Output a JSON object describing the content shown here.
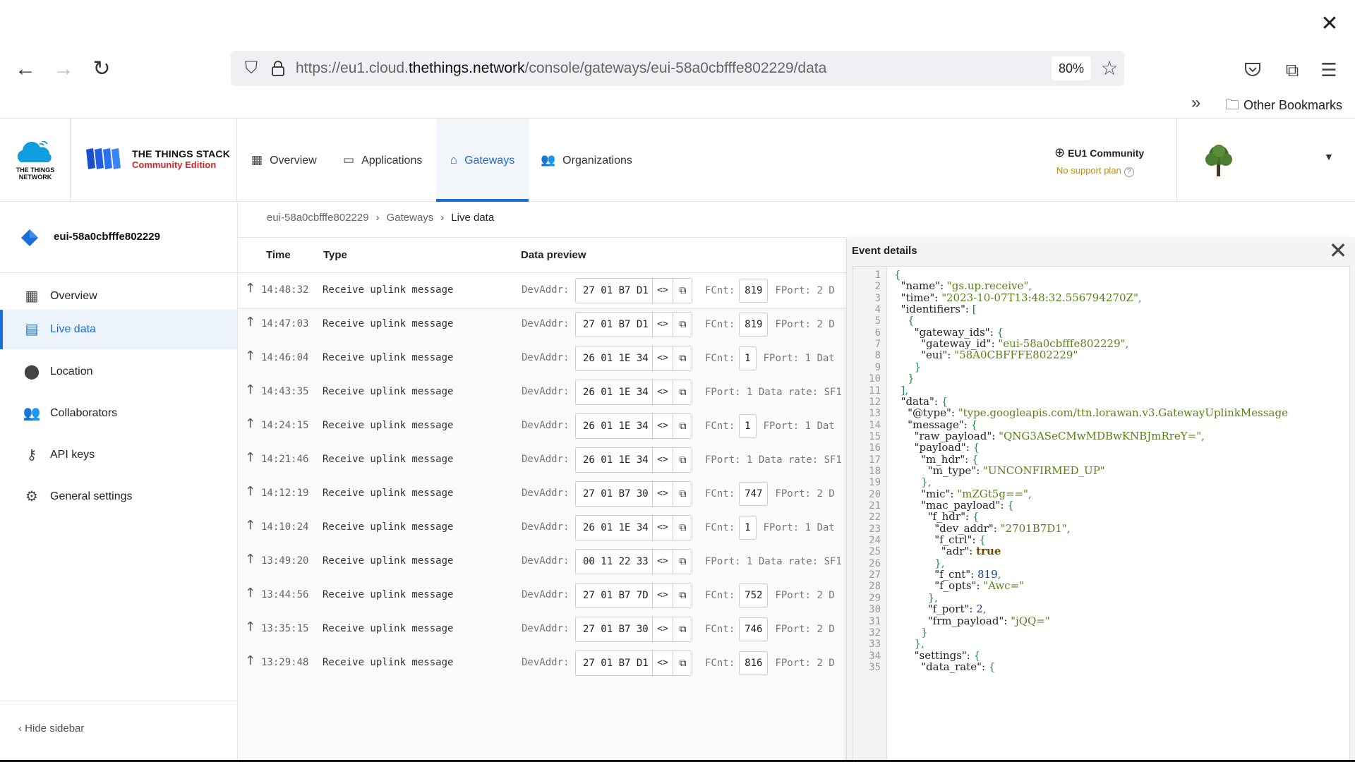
{
  "browser": {
    "url_prefix": "https://eu1.cloud.",
    "url_domain": "thethings.network",
    "url_path": "/console/gateways/eui-58a0cbfffe802229/data",
    "zoom": "80%",
    "other_bookmarks": "Other Bookmarks"
  },
  "header": {
    "ttn_logo_text": "THE THINGS NETWORK",
    "tts_title": "THE THINGS STACK",
    "tts_subtitle": "Community Edition",
    "nav": {
      "overview": "Overview",
      "applications": "Applications",
      "gateways": "Gateways",
      "organizations": "Organizations"
    },
    "cluster": "EU1 Community",
    "support": "No support plan"
  },
  "sidebar": {
    "gateway_name": "eui-58a0cbfffe802229",
    "items": [
      {
        "label": "Overview",
        "icon": "dashboard-icon"
      },
      {
        "label": "Live data",
        "icon": "live-data-icon"
      },
      {
        "label": "Location",
        "icon": "location-pin-icon"
      },
      {
        "label": "Collaborators",
        "icon": "people-icon"
      },
      {
        "label": "API keys",
        "icon": "key-icon"
      },
      {
        "label": "General settings",
        "icon": "gear-icon"
      }
    ],
    "hide_label": "Hide sidebar"
  },
  "breadcrumb": {
    "item1": "eui-58a0cbfffe802229",
    "item2": "Gateways",
    "item3": "Live data"
  },
  "table": {
    "columns": {
      "time": "Time",
      "type": "Type",
      "preview": "Data preview"
    },
    "devaddr_label": "DevAddr:",
    "rows": [
      {
        "time": "14:48:32",
        "type": "Receive uplink message",
        "devaddr": "27 01 B7 D1",
        "fcnt": "819",
        "tail": "FPort: 2  D"
      },
      {
        "time": "14:47:03",
        "type": "Receive uplink message",
        "devaddr": "27 01 B7 D1",
        "fcnt": "819",
        "tail": "FPort: 2  D"
      },
      {
        "time": "14:46:04",
        "type": "Receive uplink message",
        "devaddr": "26 01 1E 34",
        "fcnt": "1",
        "tail": "FPort: 1  Dat"
      },
      {
        "time": "14:43:35",
        "type": "Receive uplink message",
        "devaddr": "26 01 1E 34",
        "fcnt": "",
        "tail": "FPort: 1  Data rate: SF1"
      },
      {
        "time": "14:24:15",
        "type": "Receive uplink message",
        "devaddr": "26 01 1E 34",
        "fcnt": "1",
        "tail": "FPort: 1  Dat"
      },
      {
        "time": "14:21:46",
        "type": "Receive uplink message",
        "devaddr": "26 01 1E 34",
        "fcnt": "",
        "tail": "FPort: 1  Data rate: SF1"
      },
      {
        "time": "14:12:19",
        "type": "Receive uplink message",
        "devaddr": "27 01 B7 30",
        "fcnt": "747",
        "tail": "FPort: 2  D"
      },
      {
        "time": "14:10:24",
        "type": "Receive uplink message",
        "devaddr": "26 01 1E 34",
        "fcnt": "1",
        "tail": "FPort: 1  Dat"
      },
      {
        "time": "13:49:20",
        "type": "Receive uplink message",
        "devaddr": "00 11 22 33",
        "fcnt": "",
        "tail": "FPort: 1  Data rate: SF1"
      },
      {
        "time": "13:44:56",
        "type": "Receive uplink message",
        "devaddr": "27 01 B7 7D",
        "fcnt": "752",
        "tail": "FPort: 2  D"
      },
      {
        "time": "13:35:15",
        "type": "Receive uplink message",
        "devaddr": "27 01 B7 30",
        "fcnt": "746",
        "tail": "FPort: 2  D"
      },
      {
        "time": "13:29:48",
        "type": "Receive uplink message",
        "devaddr": "27 01 B7 D1",
        "fcnt": "816",
        "tail": "FPort: 2  D"
      }
    ]
  },
  "event_details": {
    "title": "Event details",
    "lines": [
      "{",
      "  \"name\": \"gs.up.receive\",",
      "  \"time\": \"2023-10-07T13:48:32.556794270Z\",",
      "  \"identifiers\": [",
      "    {",
      "      \"gateway_ids\": {",
      "        \"gateway_id\": \"eui-58a0cbfffe802229\",",
      "        \"eui\": \"58A0CBFFFE802229\"",
      "      }",
      "    }",
      "  ],",
      "  \"data\": {",
      "    \"@type\": \"type.googleapis.com/ttn.lorawan.v3.GatewayUplinkMessage",
      "    \"message\": {",
      "      \"raw_payload\": \"QNG3ASeCMwMDBwKNBJmRreY=\",",
      "      \"payload\": {",
      "        \"m_hdr\": {",
      "          \"m_type\": \"UNCONFIRMED_UP\"",
      "        },",
      "        \"mic\": \"mZGt5g==\",",
      "        \"mac_payload\": {",
      "          \"f_hdr\": {",
      "            \"dev_addr\": \"2701B7D1\",",
      "            \"f_ctrl\": {",
      "              \"adr\": true",
      "            },",
      "            \"f_cnt\": 819,",
      "            \"f_opts\": \"Awc=\"",
      "          },",
      "          \"f_port\": 2,",
      "          \"frm_payload\": \"jQQ=\"",
      "        }",
      "      },",
      "      \"settings\": {",
      "        \"data_rate\": {"
    ]
  }
}
